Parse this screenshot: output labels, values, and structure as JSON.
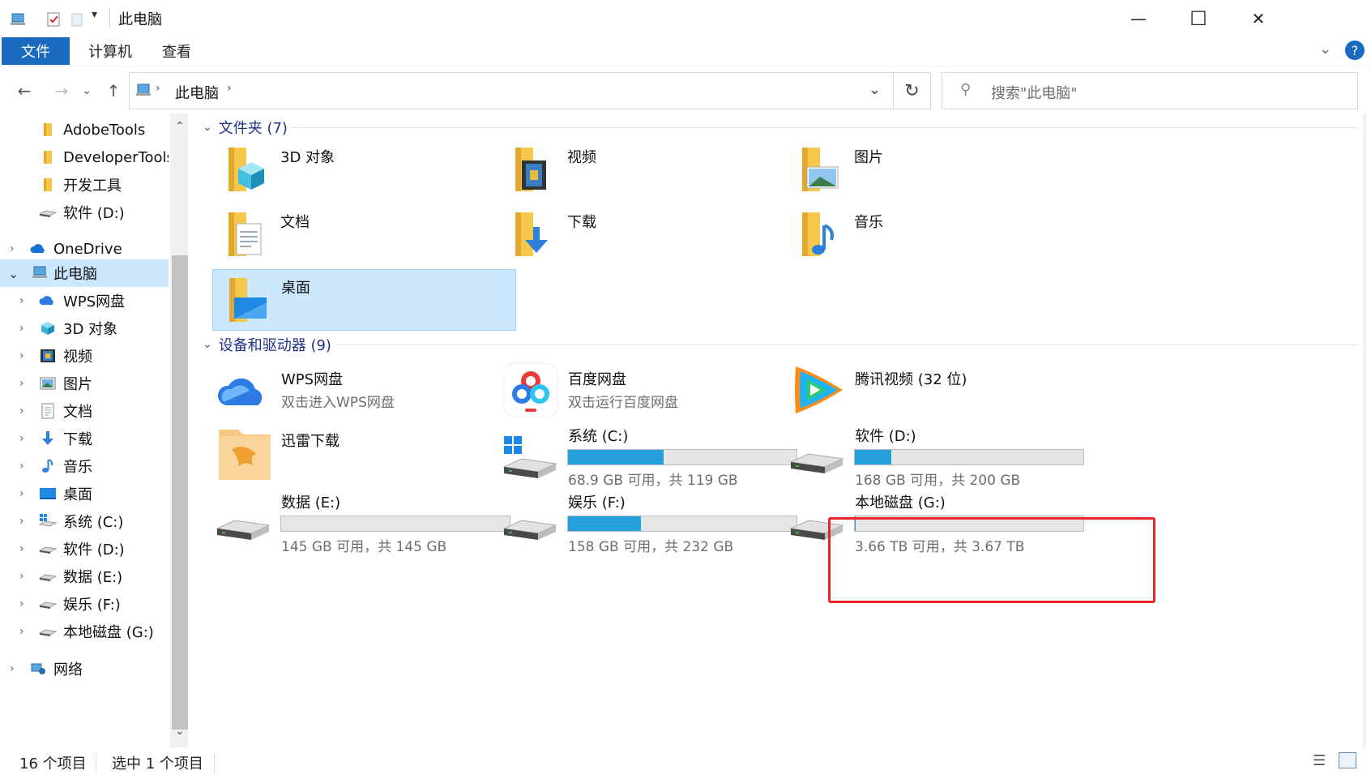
{
  "window": {
    "title": "此电脑",
    "minimize_glyph": "—",
    "maximize_glyph": "☐",
    "close_glyph": "✕"
  },
  "ribbon": {
    "tabs": [
      "文件",
      "计算机",
      "查看"
    ],
    "help": "?"
  },
  "address": {
    "path": "此电脑",
    "search_placeholder": "搜索\"此电脑\""
  },
  "sidebar": {
    "items": [
      {
        "label": "AdobeTools",
        "icon": "folder-icon"
      },
      {
        "label": "DeveloperTools",
        "icon": "folder-icon"
      },
      {
        "label": "开发工具",
        "icon": "folder-icon"
      },
      {
        "label": "软件 (D:)",
        "icon": "drive-icon"
      },
      {
        "label": "OneDrive",
        "icon": "cloud-icon"
      },
      {
        "label": "此电脑",
        "icon": "computer-icon"
      },
      {
        "label": "WPS网盘",
        "icon": "wps-cloud-icon"
      },
      {
        "label": "3D 对象",
        "icon": "cube-icon"
      },
      {
        "label": "视频",
        "icon": "video-icon"
      },
      {
        "label": "图片",
        "icon": "picture-icon"
      },
      {
        "label": "文档",
        "icon": "document-icon"
      },
      {
        "label": "下载",
        "icon": "download-icon"
      },
      {
        "label": "音乐",
        "icon": "music-icon"
      },
      {
        "label": "桌面",
        "icon": "desktop-icon"
      },
      {
        "label": "系统 (C:)",
        "icon": "system-drive-icon"
      },
      {
        "label": "软件 (D:)",
        "icon": "drive-icon"
      },
      {
        "label": "数据 (E:)",
        "icon": "drive-icon"
      },
      {
        "label": "娱乐 (F:)",
        "icon": "drive-icon"
      },
      {
        "label": "本地磁盘 (G:)",
        "icon": "drive-icon"
      },
      {
        "label": "网络",
        "icon": "network-icon"
      }
    ]
  },
  "folders_group": {
    "header": "文件夹 (7)",
    "items": [
      {
        "name": "3D 对象",
        "icon": "cube-folder-icon"
      },
      {
        "name": "视频",
        "icon": "video-folder-icon"
      },
      {
        "name": "图片",
        "icon": "picture-folder-icon"
      },
      {
        "name": "文档",
        "icon": "document-folder-icon"
      },
      {
        "name": "下载",
        "icon": "download-folder-icon"
      },
      {
        "name": "音乐",
        "icon": "music-folder-icon"
      },
      {
        "name": "桌面",
        "icon": "desktop-folder-icon"
      }
    ]
  },
  "devices_group": {
    "header": "设备和驱动器 (9)",
    "apps": [
      {
        "name": "WPS网盘",
        "sub": "双击进入WPS网盘",
        "icon": "wps-cloud-icon"
      },
      {
        "name": "百度网盘",
        "sub": "双击运行百度网盘",
        "icon": "baidu-netdisk-icon"
      },
      {
        "name": "腾讯视频 (32 位)",
        "sub": "",
        "icon": "tencent-video-icon"
      },
      {
        "name": "迅雷下载",
        "sub": "",
        "icon": "xunlei-icon"
      }
    ],
    "drives": [
      {
        "name": "系统 (C:)",
        "info": "68.9 GB 可用，共 119 GB",
        "used": 0.42
      },
      {
        "name": "软件 (D:)",
        "info": "168 GB 可用，共 200 GB",
        "used": 0.16
      },
      {
        "name": "数据 (E:)",
        "info": "145 GB 可用，共 145 GB",
        "used": 0.0
      },
      {
        "name": "娱乐 (F:)",
        "info": "158 GB 可用，共 232 GB",
        "used": 0.32
      },
      {
        "name": "本地磁盘 (G:)",
        "info": "3.66 TB 可用，共 3.67 TB",
        "used": 0.003
      }
    ]
  },
  "status": {
    "count": "16 个项目",
    "selected": "选中 1 个项目"
  },
  "colors": {
    "accent": "#1a6bc0",
    "selection": "#cce8ff",
    "drive_fill": "#26a0da",
    "highlight_box": "#e8232a"
  }
}
